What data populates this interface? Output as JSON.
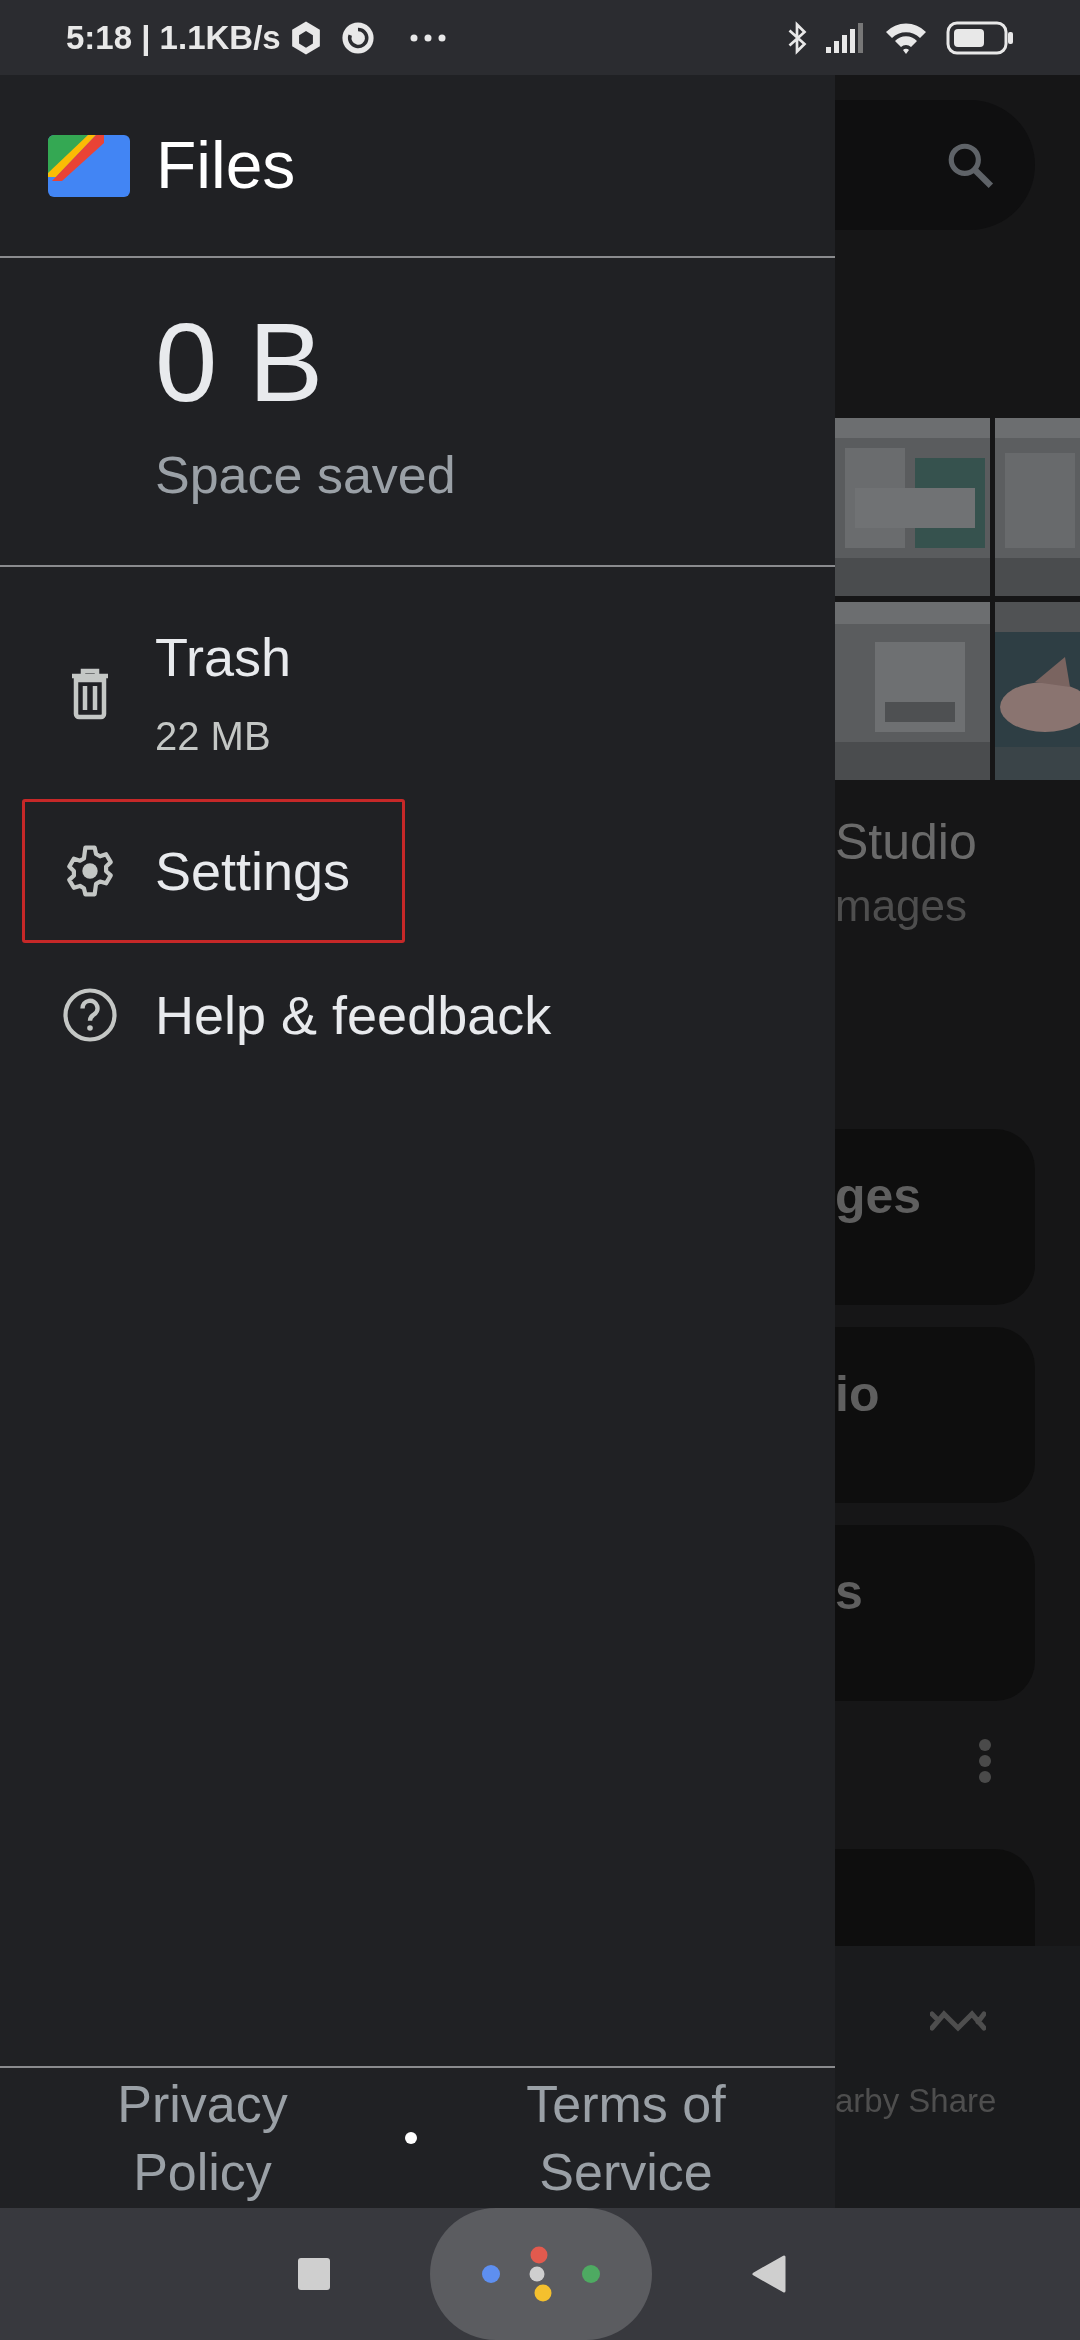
{
  "status_bar": {
    "time_speed": "5:18 | 1.1KB/s"
  },
  "drawer": {
    "app_title": "Files",
    "savings": {
      "value": "0 B",
      "label": "Space saved"
    },
    "items": [
      {
        "label": "Trash",
        "detail": "22 MB",
        "highlighted": false
      },
      {
        "label": "Settings",
        "highlighted": true
      },
      {
        "label": "Help & feedback",
        "highlighted": false
      }
    ],
    "footer_links": [
      "Privacy Policy",
      "Terms of Service"
    ]
  },
  "background": {
    "collection": {
      "title": "Studio",
      "subtitle": "mages"
    },
    "categories": [
      {
        "label": "ges"
      },
      {
        "label": "io"
      },
      {
        "label": "s"
      }
    ],
    "bottom_nav": {
      "label": "arby Share"
    }
  }
}
